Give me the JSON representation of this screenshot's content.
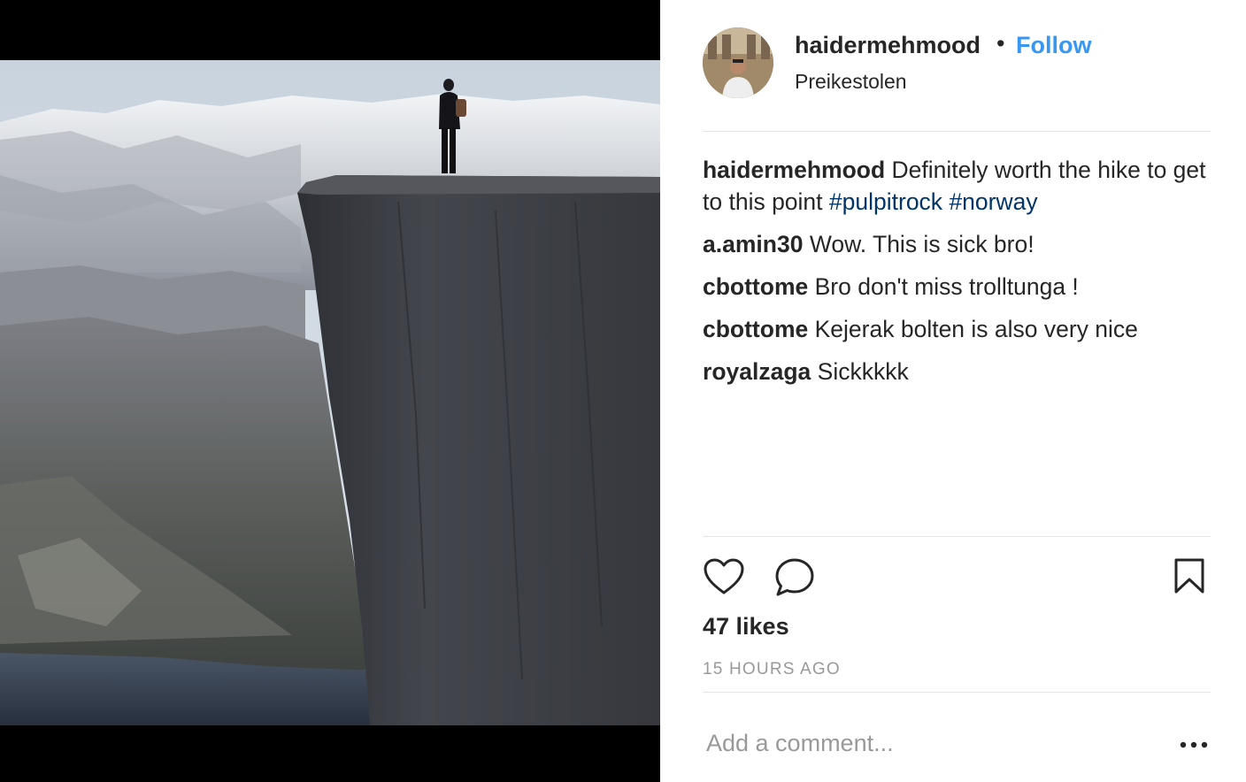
{
  "post": {
    "username": "haidermehmood",
    "separator": "•",
    "follow_label": "Follow",
    "location": "Preikestolen"
  },
  "caption": {
    "username": "haidermehmood",
    "text": "Definitely worth the hike to get to this point",
    "hashtags": [
      "#pulpitrock",
      "#norway"
    ]
  },
  "comments": [
    {
      "username": "a.amin30",
      "text": "Wow. This is sick bro!"
    },
    {
      "username": "cbottome",
      "text": "Bro don't miss trolltunga !"
    },
    {
      "username": "cbottome",
      "text": "Kejerak bolten is also very nice"
    },
    {
      "username": "royalzaga",
      "text": "Sickkkkk"
    }
  ],
  "actions": {
    "like_icon": "heart-outline-icon",
    "comment_icon": "speech-bubble-icon",
    "save_icon": "bookmark-icon",
    "more_icon": "ellipsis-icon"
  },
  "likes": "47 likes",
  "timestamp": "15 HOURS AGO",
  "add_comment": {
    "placeholder": "Add a comment..."
  },
  "colors": {
    "follow": "#3897f0",
    "hashtag": "#003569",
    "muted": "#999999",
    "text": "#262626",
    "divider": "#e6e6e6"
  }
}
